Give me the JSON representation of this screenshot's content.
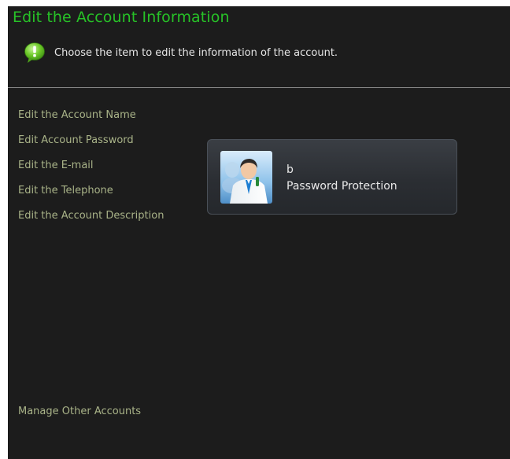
{
  "header": {
    "title": "Edit the Account Information",
    "hint": "Choose the item to edit the information of the account.",
    "hint_icon": "speech-bubble-exclamation-icon"
  },
  "menu": {
    "items": [
      {
        "label": "Edit the Account Name"
      },
      {
        "label": "Edit Account Password"
      },
      {
        "label": "Edit the E-mail"
      },
      {
        "label": "Edit the Telephone"
      },
      {
        "label": "Edit the Account Description"
      }
    ],
    "manage_label": "Manage Other Accounts"
  },
  "account": {
    "name": "b",
    "status": "Password Protection",
    "avatar_icon": "user-avatar-icon"
  },
  "colors": {
    "background": "#1c1c1c",
    "title": "#27c227",
    "menu_text": "#a9b388",
    "text": "#e6e6e6"
  }
}
